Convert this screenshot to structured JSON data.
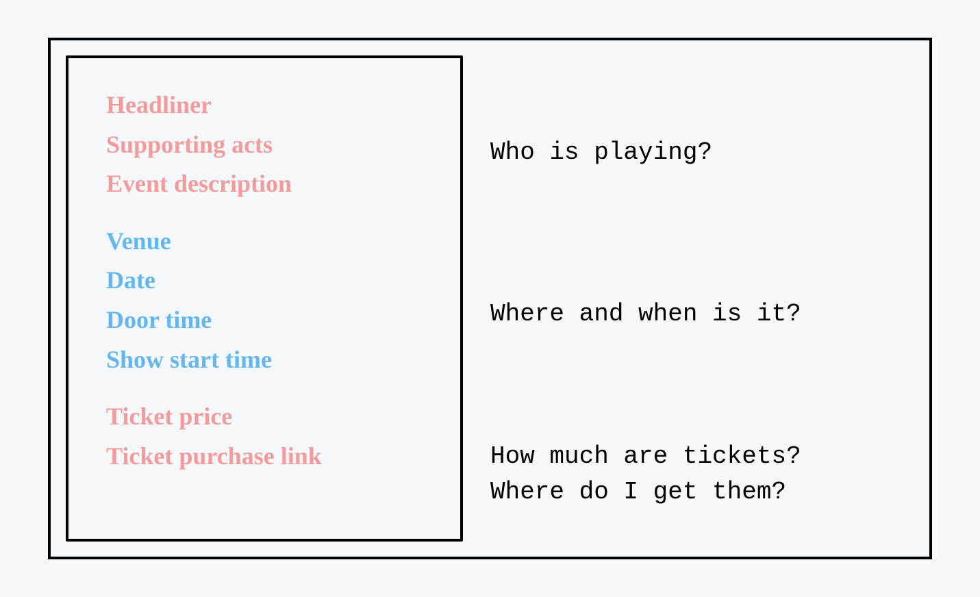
{
  "left": {
    "group1": {
      "item1": "Headliner",
      "item2": "Supporting acts",
      "item3": "Event description"
    },
    "group2": {
      "item1": "Venue",
      "item2": "Date",
      "item3": "Door time",
      "item4": "Show start time"
    },
    "group3": {
      "item1": "Ticket price",
      "item2": "Ticket purchase link"
    }
  },
  "right": {
    "q1": "Who is playing?",
    "q2": "Where and when is it?",
    "q3_line1": "How much are tickets?",
    "q3_line2": "Where do I get them?"
  }
}
